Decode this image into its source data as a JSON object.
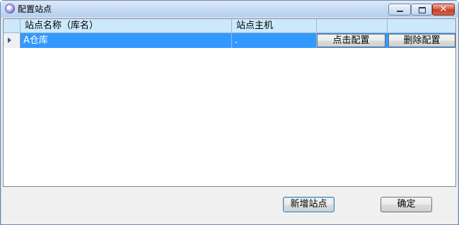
{
  "window": {
    "title": "配置站点",
    "icon": "app-icon",
    "controls": {
      "minimize": "minimize-icon",
      "maximize": "maximize-icon",
      "close": "✕"
    }
  },
  "grid": {
    "columns": [
      "",
      "站点名称（库名）",
      "站点主机",
      "",
      ""
    ],
    "rows": [
      {
        "selected": true,
        "site_name": "A仓库",
        "host": ".",
        "configure_label": "点击配置",
        "delete_label": "删除配置"
      }
    ]
  },
  "buttons": {
    "add_site": "新增站点",
    "ok": "确定"
  },
  "colors": {
    "selection": "#3399ff",
    "header_bg": "#cce8fb",
    "close_button": "#c63a22"
  }
}
